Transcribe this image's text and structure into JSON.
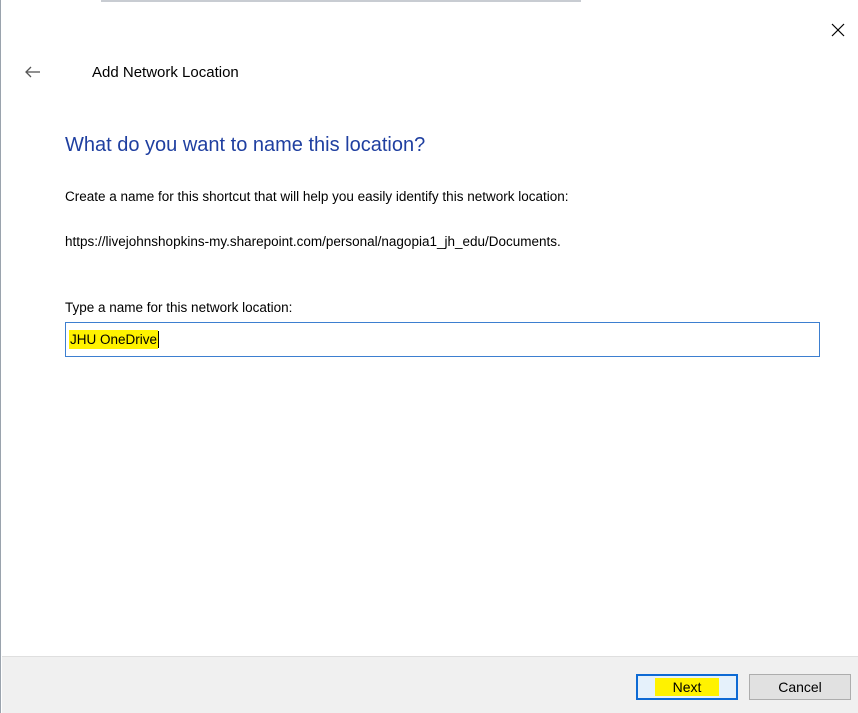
{
  "window": {
    "title": "Add Network Location",
    "close_icon": "close-icon",
    "back_icon": "back-arrow-icon"
  },
  "page": {
    "heading": "What do you want to name this location?",
    "description": "Create a name for this shortcut that will help you easily identify this network location:",
    "url": "https://livejohnshopkins-my.sharepoint.com/personal/nagopia1_jh_edu/Documents.",
    "field_label": "Type a name for this network location:",
    "name_value": "JHU OneDrive"
  },
  "footer": {
    "next_label": "Next",
    "cancel_label": "Cancel"
  },
  "colors": {
    "heading": "#1f3fa0",
    "highlight": "#fff200",
    "focus_border": "#3d7fd0"
  }
}
